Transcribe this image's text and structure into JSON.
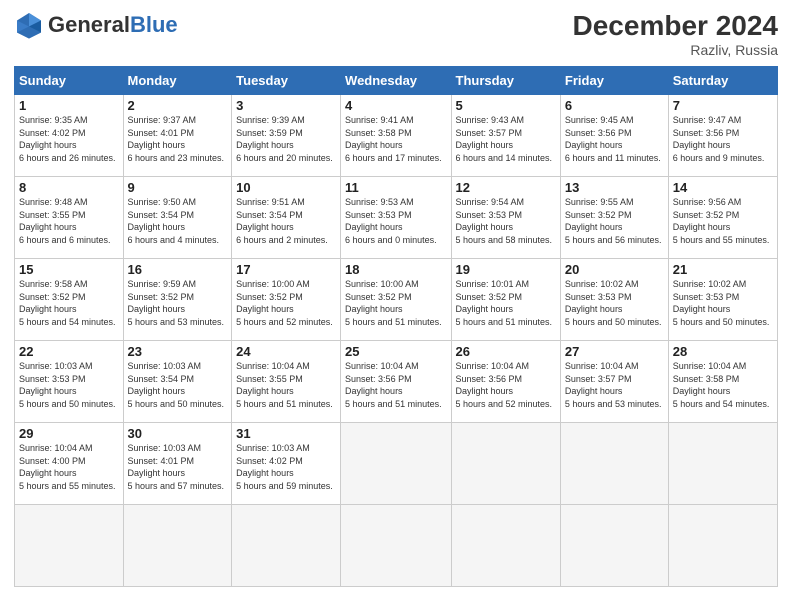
{
  "header": {
    "logo_general": "General",
    "logo_blue": "Blue",
    "month_title": "December 2024",
    "location": "Razliv, Russia"
  },
  "weekdays": [
    "Sunday",
    "Monday",
    "Tuesday",
    "Wednesday",
    "Thursday",
    "Friday",
    "Saturday"
  ],
  "days": [
    {
      "num": "1",
      "sunrise": "9:35 AM",
      "sunset": "4:02 PM",
      "daylight": "6 hours and 26 minutes."
    },
    {
      "num": "2",
      "sunrise": "9:37 AM",
      "sunset": "4:01 PM",
      "daylight": "6 hours and 23 minutes."
    },
    {
      "num": "3",
      "sunrise": "9:39 AM",
      "sunset": "3:59 PM",
      "daylight": "6 hours and 20 minutes."
    },
    {
      "num": "4",
      "sunrise": "9:41 AM",
      "sunset": "3:58 PM",
      "daylight": "6 hours and 17 minutes."
    },
    {
      "num": "5",
      "sunrise": "9:43 AM",
      "sunset": "3:57 PM",
      "daylight": "6 hours and 14 minutes."
    },
    {
      "num": "6",
      "sunrise": "9:45 AM",
      "sunset": "3:56 PM",
      "daylight": "6 hours and 11 minutes."
    },
    {
      "num": "7",
      "sunrise": "9:47 AM",
      "sunset": "3:56 PM",
      "daylight": "6 hours and 9 minutes."
    },
    {
      "num": "8",
      "sunrise": "9:48 AM",
      "sunset": "3:55 PM",
      "daylight": "6 hours and 6 minutes."
    },
    {
      "num": "9",
      "sunrise": "9:50 AM",
      "sunset": "3:54 PM",
      "daylight": "6 hours and 4 minutes."
    },
    {
      "num": "10",
      "sunrise": "9:51 AM",
      "sunset": "3:54 PM",
      "daylight": "6 hours and 2 minutes."
    },
    {
      "num": "11",
      "sunrise": "9:53 AM",
      "sunset": "3:53 PM",
      "daylight": "6 hours and 0 minutes."
    },
    {
      "num": "12",
      "sunrise": "9:54 AM",
      "sunset": "3:53 PM",
      "daylight": "5 hours and 58 minutes."
    },
    {
      "num": "13",
      "sunrise": "9:55 AM",
      "sunset": "3:52 PM",
      "daylight": "5 hours and 56 minutes."
    },
    {
      "num": "14",
      "sunrise": "9:56 AM",
      "sunset": "3:52 PM",
      "daylight": "5 hours and 55 minutes."
    },
    {
      "num": "15",
      "sunrise": "9:58 AM",
      "sunset": "3:52 PM",
      "daylight": "5 hours and 54 minutes."
    },
    {
      "num": "16",
      "sunrise": "9:59 AM",
      "sunset": "3:52 PM",
      "daylight": "5 hours and 53 minutes."
    },
    {
      "num": "17",
      "sunrise": "10:00 AM",
      "sunset": "3:52 PM",
      "daylight": "5 hours and 52 minutes."
    },
    {
      "num": "18",
      "sunrise": "10:00 AM",
      "sunset": "3:52 PM",
      "daylight": "5 hours and 51 minutes."
    },
    {
      "num": "19",
      "sunrise": "10:01 AM",
      "sunset": "3:52 PM",
      "daylight": "5 hours and 51 minutes."
    },
    {
      "num": "20",
      "sunrise": "10:02 AM",
      "sunset": "3:53 PM",
      "daylight": "5 hours and 50 minutes."
    },
    {
      "num": "21",
      "sunrise": "10:02 AM",
      "sunset": "3:53 PM",
      "daylight": "5 hours and 50 minutes."
    },
    {
      "num": "22",
      "sunrise": "10:03 AM",
      "sunset": "3:53 PM",
      "daylight": "5 hours and 50 minutes."
    },
    {
      "num": "23",
      "sunrise": "10:03 AM",
      "sunset": "3:54 PM",
      "daylight": "5 hours and 50 minutes."
    },
    {
      "num": "24",
      "sunrise": "10:04 AM",
      "sunset": "3:55 PM",
      "daylight": "5 hours and 51 minutes."
    },
    {
      "num": "25",
      "sunrise": "10:04 AM",
      "sunset": "3:56 PM",
      "daylight": "5 hours and 51 minutes."
    },
    {
      "num": "26",
      "sunrise": "10:04 AM",
      "sunset": "3:56 PM",
      "daylight": "5 hours and 52 minutes."
    },
    {
      "num": "27",
      "sunrise": "10:04 AM",
      "sunset": "3:57 PM",
      "daylight": "5 hours and 53 minutes."
    },
    {
      "num": "28",
      "sunrise": "10:04 AM",
      "sunset": "3:58 PM",
      "daylight": "5 hours and 54 minutes."
    },
    {
      "num": "29",
      "sunrise": "10:04 AM",
      "sunset": "4:00 PM",
      "daylight": "5 hours and 55 minutes."
    },
    {
      "num": "30",
      "sunrise": "10:03 AM",
      "sunset": "4:01 PM",
      "daylight": "5 hours and 57 minutes."
    },
    {
      "num": "31",
      "sunrise": "10:03 AM",
      "sunset": "4:02 PM",
      "daylight": "5 hours and 59 minutes."
    }
  ]
}
